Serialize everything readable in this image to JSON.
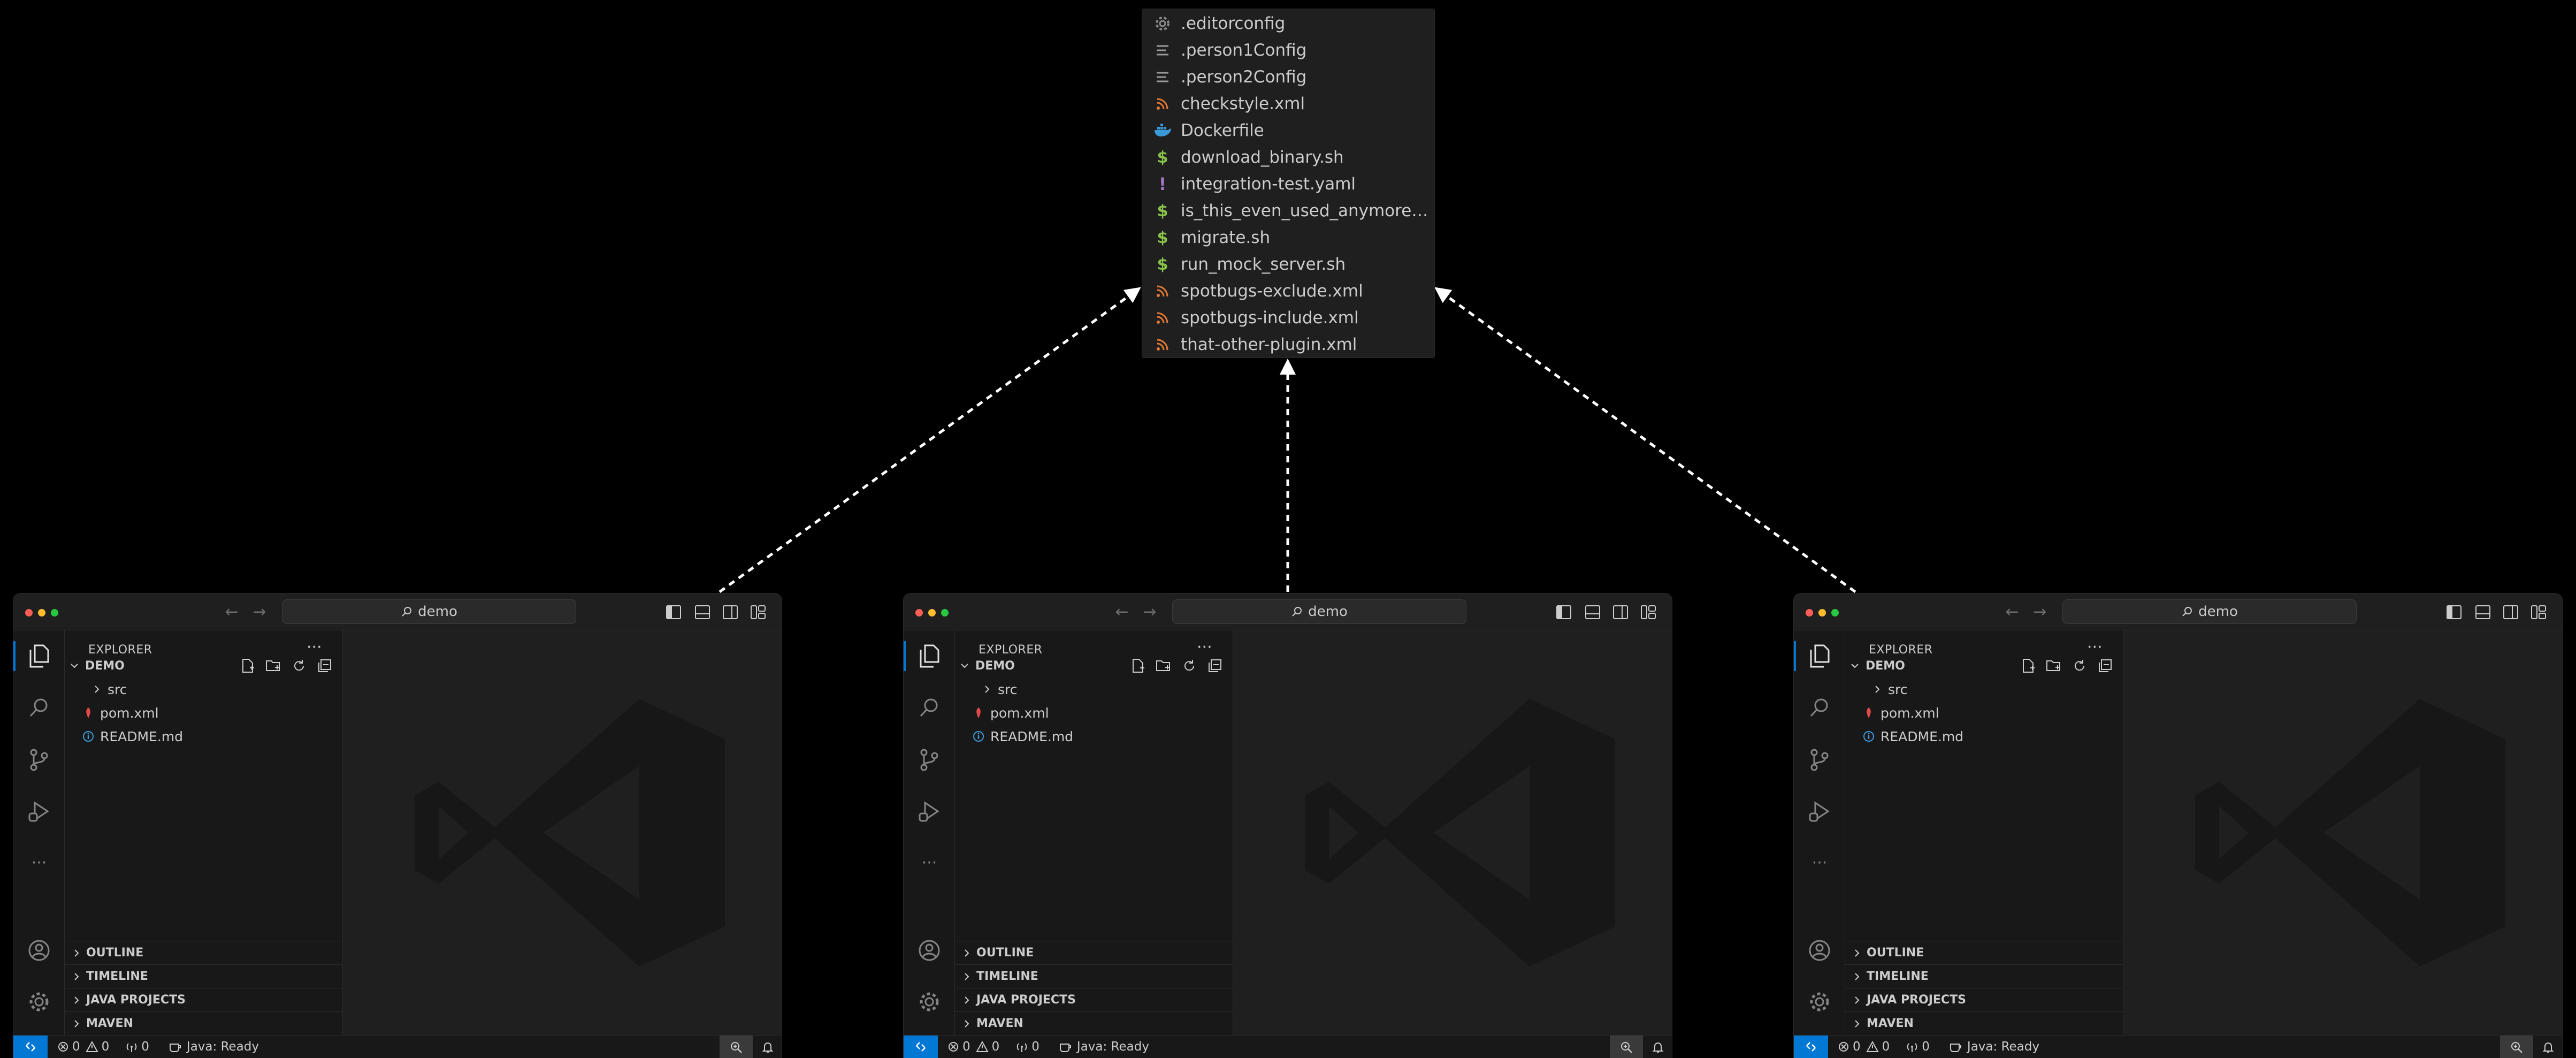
{
  "file_list": [
    {
      "name": ".editorconfig",
      "icon": "gear-icon",
      "color": "#8a8a8a"
    },
    {
      "name": ".person1Config",
      "icon": "lines-icon",
      "color": "#9a9a9a"
    },
    {
      "name": ".person2Config",
      "icon": "lines-icon",
      "color": "#9a9a9a"
    },
    {
      "name": "checkstyle.xml",
      "icon": "rss-icon",
      "color": "#e37933"
    },
    {
      "name": "Dockerfile",
      "icon": "docker-icon",
      "color": "#3a9ad9"
    },
    {
      "name": "download_binary.sh",
      "icon": "dollar-icon",
      "color": "#89c34a"
    },
    {
      "name": "integration-test.yaml",
      "icon": "exclamation-icon",
      "color": "#a074c4"
    },
    {
      "name": "is_this_even_used_anymore_best...",
      "icon": "dollar-icon",
      "color": "#89c34a"
    },
    {
      "name": "migrate.sh",
      "icon": "dollar-icon",
      "color": "#89c34a"
    },
    {
      "name": "run_mock_server.sh",
      "icon": "dollar-icon",
      "color": "#89c34a"
    },
    {
      "name": "spotbugs-exclude.xml",
      "icon": "rss-icon",
      "color": "#e37933"
    },
    {
      "name": "spotbugs-include.xml",
      "icon": "rss-icon",
      "color": "#e37933"
    },
    {
      "name": "that-other-plugin.xml",
      "icon": "rss-icon",
      "color": "#e37933"
    }
  ],
  "windows": [
    {
      "search": "demo",
      "explorer_title": "EXPLORER",
      "more": "···",
      "project": "DEMO",
      "tree": [
        {
          "name": "src",
          "type": "folder",
          "icon": "chevron-right-icon"
        },
        {
          "name": "pom.xml",
          "type": "file",
          "icon": "maven-icon"
        },
        {
          "name": "README.md",
          "type": "file",
          "icon": "info-icon"
        }
      ],
      "sections": [
        "OUTLINE",
        "TIMELINE",
        "JAVA PROJECTS",
        "MAVEN"
      ],
      "status": {
        "errors": "0",
        "warnings": "0",
        "ports": "0",
        "java": "Java: Ready"
      }
    },
    {
      "search": "demo",
      "explorer_title": "EXPLORER",
      "more": "···",
      "project": "DEMO",
      "tree": [
        {
          "name": "src",
          "type": "folder",
          "icon": "chevron-right-icon"
        },
        {
          "name": "pom.xml",
          "type": "file",
          "icon": "maven-icon"
        },
        {
          "name": "README.md",
          "type": "file",
          "icon": "info-icon"
        }
      ],
      "sections": [
        "OUTLINE",
        "TIMELINE",
        "JAVA PROJECTS",
        "MAVEN"
      ],
      "status": {
        "errors": "0",
        "warnings": "0",
        "ports": "0",
        "java": "Java: Ready"
      }
    },
    {
      "search": "demo",
      "explorer_title": "EXPLORER",
      "more": "···",
      "project": "DEMO",
      "tree": [
        {
          "name": "src",
          "type": "folder",
          "icon": "chevron-right-icon"
        },
        {
          "name": "pom.xml",
          "type": "file",
          "icon": "maven-icon"
        },
        {
          "name": "README.md",
          "type": "file",
          "icon": "info-icon"
        }
      ],
      "sections": [
        "OUTLINE",
        "TIMELINE",
        "JAVA PROJECTS",
        "MAVEN"
      ],
      "status": {
        "errors": "0",
        "warnings": "0",
        "ports": "0",
        "java": "Java: Ready"
      }
    }
  ],
  "colors": {
    "accent": "#0078d4",
    "background": "#000000",
    "panel": "#181818",
    "editor": "#1f1f1f"
  }
}
